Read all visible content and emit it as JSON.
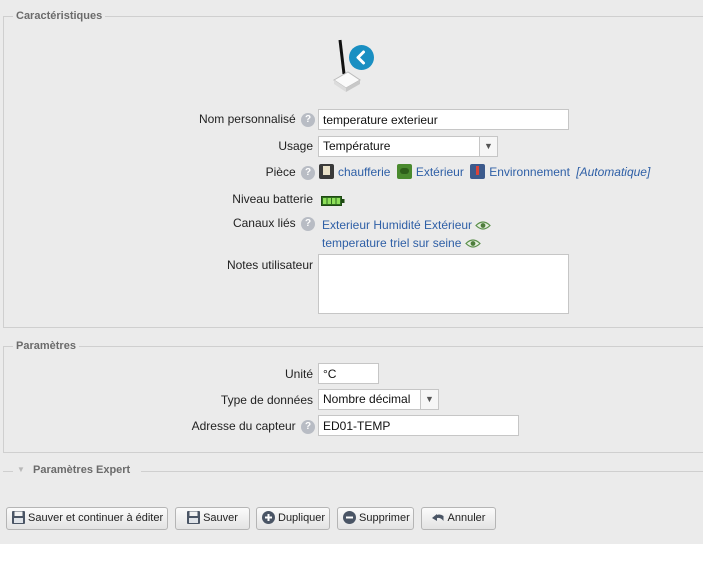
{
  "caracteristiques": {
    "legend": "Caractéristiques",
    "nom": {
      "label": "Nom personnalisé",
      "value": "temperature exterieur"
    },
    "usage": {
      "label": "Usage",
      "value": "Température"
    },
    "piece": {
      "label": "Pièce",
      "items": [
        "chaufferie",
        "Extérieur",
        "Environnement"
      ],
      "auto": "[Automatique]"
    },
    "batterie": {
      "label": "Niveau batterie"
    },
    "canaux": {
      "label": "Canaux liés",
      "items": [
        "Exterieur Humidité Extérieur",
        "temperature triel sur seine"
      ]
    },
    "notes": {
      "label": "Notes utilisateur",
      "value": ""
    }
  },
  "parametres": {
    "legend": "Paramètres",
    "unite": {
      "label": "Unité",
      "value": "°C"
    },
    "type": {
      "label": "Type de données",
      "value": "Nombre décimal"
    },
    "adresse": {
      "label": "Adresse du capteur",
      "value": "ED01-TEMP"
    }
  },
  "expert": {
    "label": "Paramètres Expert"
  },
  "buttons": {
    "save_continue": "Sauver et continuer à éditer",
    "save": "Sauver",
    "duplicate": "Dupliquer",
    "delete": "Supprimer",
    "cancel": "Annuler"
  },
  "colors": {
    "link": "#2e5fa6",
    "badge": "#1a8fc2",
    "background": "#ebebeb"
  }
}
